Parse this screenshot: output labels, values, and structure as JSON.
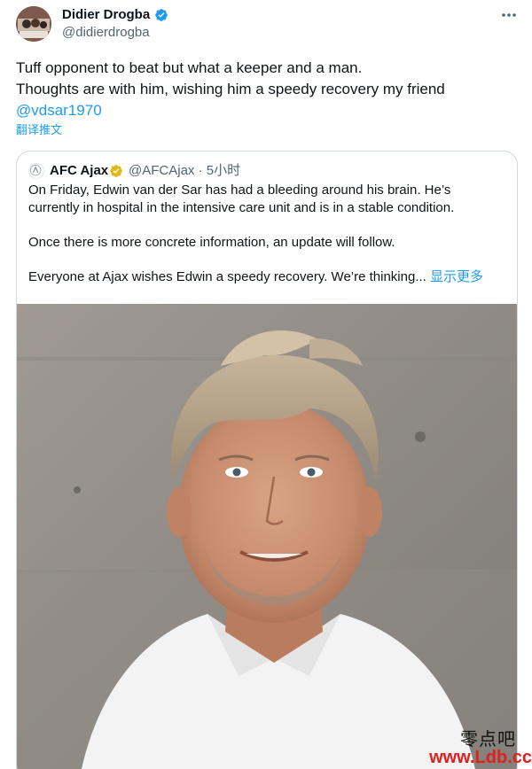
{
  "author": {
    "name": "Didier Drogba",
    "handle": "@didierdrogba",
    "verified": true,
    "badge_color": "#1d9bf0"
  },
  "tweet": {
    "line1": "Tuff opponent to beat but what a keeper and a man.",
    "line2": "Thoughts are with him, wishing him a speedy recovery my friend",
    "mention": "@vdsar1970",
    "translate_label": "翻译推文"
  },
  "quoted": {
    "name": "AFC Ajax",
    "handle": "@AFCAjax",
    "separator": "·",
    "time": "5小时",
    "verified": true,
    "badge_color": "#e2b719",
    "paragraph1_line1": "On Friday, Edwin van der Sar has had a bleeding around his brain. He’s",
    "paragraph1_line2": "currently in hospital in the intensive care unit and is in a stable condition.",
    "paragraph2": "Once there is more concrete information, an update will follow.",
    "paragraph3": "Everyone at Ajax wishes Edwin a speedy recovery. We’re thinking...",
    "show_more": "显示更多"
  },
  "icons": {
    "more": "more-horizontal-icon",
    "verified": "verified-badge-icon"
  },
  "watermark": {
    "chinese": "零点吧",
    "url": "www.Ldb.cc"
  },
  "colors": {
    "link": "#1d9bf0",
    "text": "#0f1419",
    "secondary": "#536471",
    "border": "#cfd9de",
    "watermark_url": "#e02020"
  }
}
